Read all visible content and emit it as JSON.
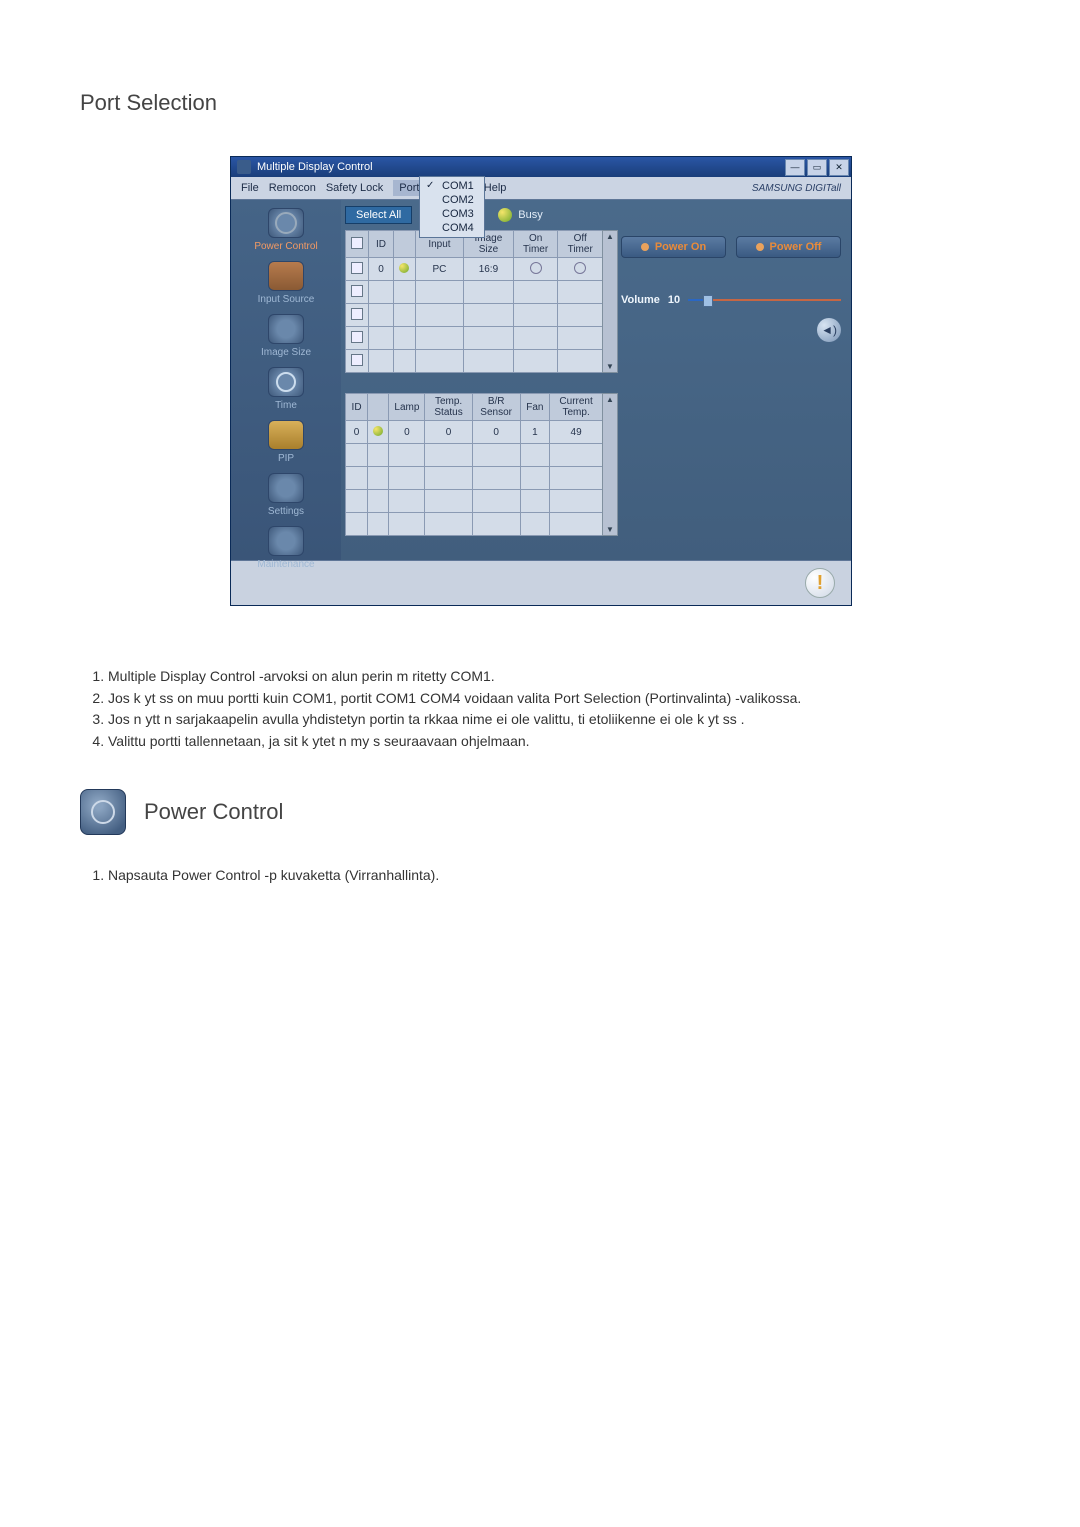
{
  "section1_title": "Port Selection",
  "app_window": {
    "title": "Multiple Display Control",
    "brand": "SAMSUNG DIGITall",
    "menubar": [
      "File",
      "Remocon",
      "Safety Lock",
      "Port Selection",
      "Help"
    ],
    "port_menu": {
      "items": [
        {
          "label": "COM1",
          "checked": true
        },
        {
          "label": "COM2",
          "checked": false
        },
        {
          "label": "COM3",
          "checked": false
        },
        {
          "label": "COM4",
          "checked": false
        }
      ]
    },
    "sidebar": [
      {
        "label": "Power Control",
        "icon": "power",
        "active": true
      },
      {
        "label": "Input Source",
        "icon": "input",
        "active": false
      },
      {
        "label": "Image Size",
        "icon": "image",
        "active": false
      },
      {
        "label": "Time",
        "icon": "time",
        "active": false
      },
      {
        "label": "PIP",
        "icon": "pip",
        "active": false
      },
      {
        "label": "Settings",
        "icon": "settings",
        "active": false
      },
      {
        "label": "Maintenance",
        "icon": "maintenance",
        "active": false
      }
    ],
    "select_all": "Select All",
    "busy_label": "Busy",
    "upper_grid": {
      "headers": [
        "",
        "ID",
        "",
        "Input",
        "Image Size",
        "On Timer",
        "Off Timer"
      ],
      "rows": [
        {
          "id": "0",
          "input": "PC",
          "image_size": "16:9"
        }
      ],
      "blank_rows": 4
    },
    "lower_grid": {
      "headers": [
        "ID",
        "",
        "Lamp",
        "Temp. Status",
        "B/R Sensor",
        "Fan",
        "Current Temp."
      ],
      "rows": [
        {
          "id": "0",
          "lamp": "0",
          "temp_status": "0",
          "br": "0",
          "fan": "1",
          "ctemp": "49"
        }
      ],
      "blank_rows": 4
    },
    "power_buttons": {
      "on": "Power On",
      "off": "Power Off"
    },
    "volume": {
      "label": "Volume",
      "value": "10"
    }
  },
  "list1": [
    "Multiple Display Control -arvoksi on alun perin m  ritetty COM1.",
    "Jos k yt ss  on muu portti kuin COM1, portit COM1 COM4   voidaan valita Port Selection (Portinvalinta) -valikossa.",
    "Jos n ytt  n sarjakaapelin avulla yhdistetyn portin ta   rkkaa nime  ei ole valittu, ti  etoliikenne ei ole k yt ss .",
    "Valittu portti tallennetaan, ja sit   k  ytet  n my s seuraavaan ohjelmaan."
  ],
  "section2_title": "Power Control",
  "list2": [
    "Napsauta Power Control -p  kuvaketta (Virranhallinta)."
  ]
}
